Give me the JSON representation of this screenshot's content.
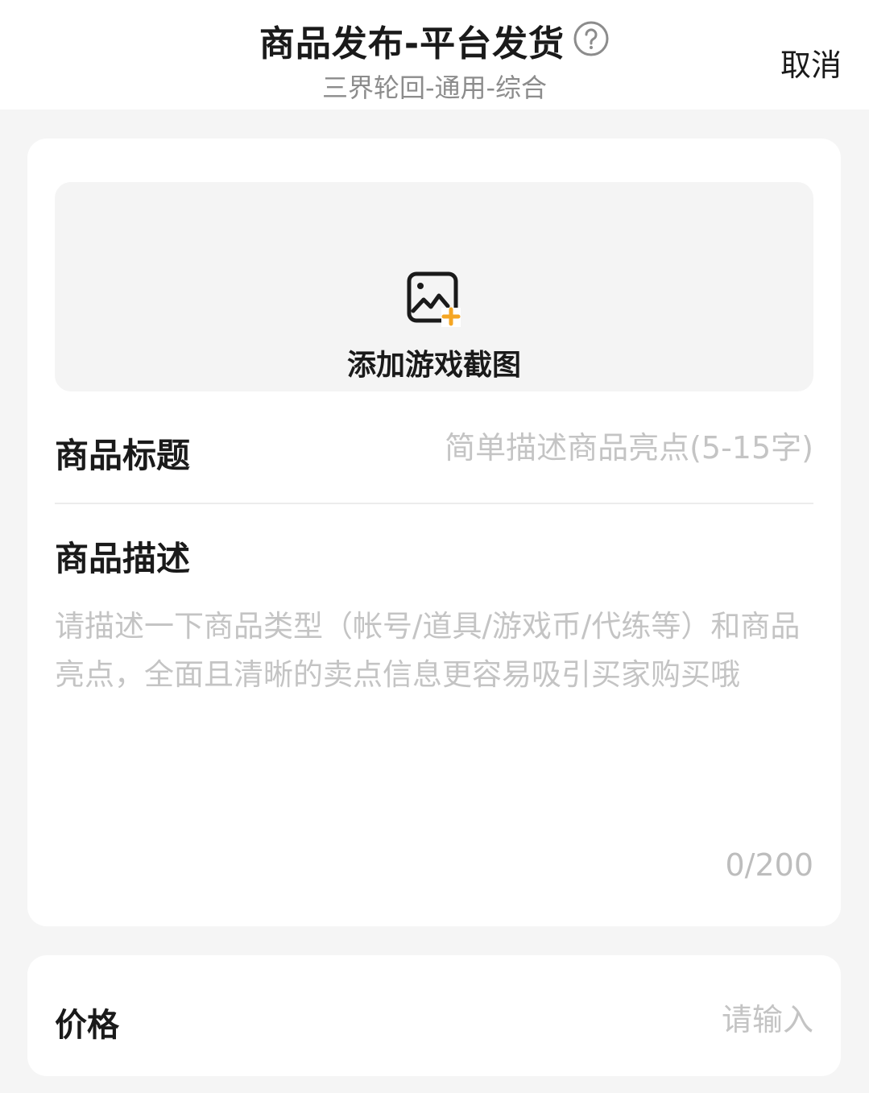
{
  "header": {
    "title": "商品发布-平台发货",
    "help_icon": "question-circle-icon",
    "subtitle": "三界轮回-通用-综合",
    "cancel_label": "取消"
  },
  "upload": {
    "icon": "image-add-icon",
    "icon_accent_color": "#f5a623",
    "label": "添加游戏截图"
  },
  "product_title": {
    "label": "商品标题",
    "value": "",
    "placeholder": "简单描述商品亮点(5-15字)"
  },
  "product_description": {
    "label": "商品描述",
    "value": "",
    "placeholder": "请描述一下商品类型（帐号/道具/游戏币/代练等）和商品亮点，全面且清晰的卖点信息更容易吸引买家购买哦",
    "counter": "0/200"
  },
  "price": {
    "label": "价格",
    "value": "",
    "placeholder": "请输入"
  }
}
